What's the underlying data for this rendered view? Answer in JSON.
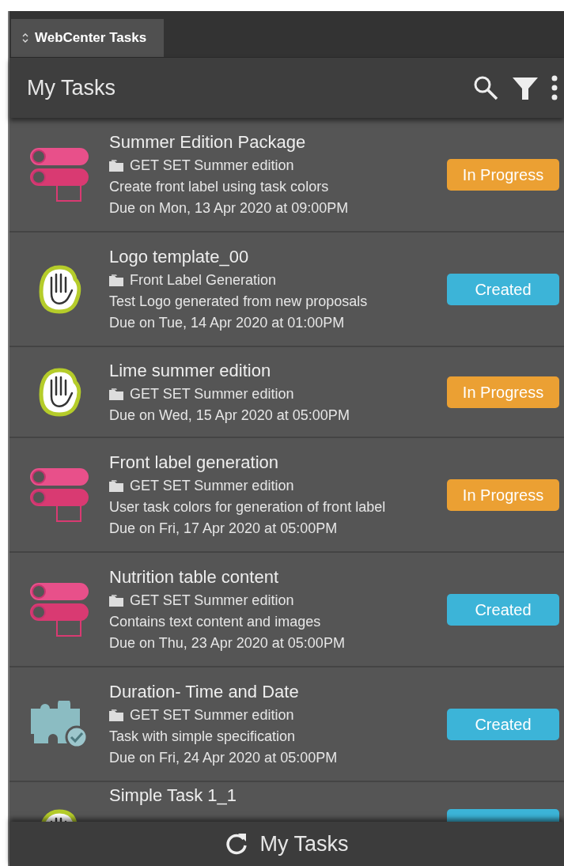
{
  "tab": {
    "label": "WebCenter Tasks",
    "selected": true
  },
  "header": {
    "title": "My Tasks"
  },
  "tasks": [
    {
      "kind": "toggle",
      "title": "Summer Edition Package",
      "project": "GET SET Summer edition",
      "description": "Create front label using task colors",
      "due": "Due on Mon, 13 Apr 2020 at 09:00PM",
      "status": {
        "kind": "in_progress",
        "label": "In Progress"
      }
    },
    {
      "kind": "hand",
      "title": "Logo template_00",
      "project": "Front Label Generation",
      "description": "Test Logo generated from new proposals",
      "due": "Due on Tue, 14 Apr 2020 at 01:00PM",
      "status": {
        "kind": "created",
        "label": "Created"
      }
    },
    {
      "kind": "hand",
      "title": "Lime summer edition",
      "project": "GET SET Summer edition",
      "due": "Due on Wed, 15 Apr 2020 at 05:00PM",
      "status": {
        "kind": "in_progress",
        "label": "In Progress"
      }
    },
    {
      "kind": "toggle",
      "title": "Front label generation",
      "project": "GET SET Summer edition",
      "description": "User task colors for generation of front label",
      "due": "Due on Fri, 17 Apr 2020 at 05:00PM",
      "status": {
        "kind": "in_progress",
        "label": "In Progress"
      }
    },
    {
      "kind": "toggle",
      "title": "Nutrition table content",
      "project": "GET SET Summer edition",
      "description": "Contains text content and images",
      "due": "Due on Thu, 23 Apr 2020 at 05:00PM",
      "status": {
        "kind": "created",
        "label": "Created"
      }
    },
    {
      "kind": "puzzle",
      "title": "Duration- Time and Date",
      "project": "GET SET Summer edition",
      "description": "Task with simple specification",
      "due": "Due on Fri, 24 Apr 2020 at 05:00PM",
      "status": {
        "kind": "created",
        "label": "Created"
      }
    },
    {
      "kind": "hand",
      "title": "Simple Task 1_1",
      "status": {
        "kind": "created"
      }
    }
  ],
  "footer": {
    "label": "My Tasks"
  }
}
